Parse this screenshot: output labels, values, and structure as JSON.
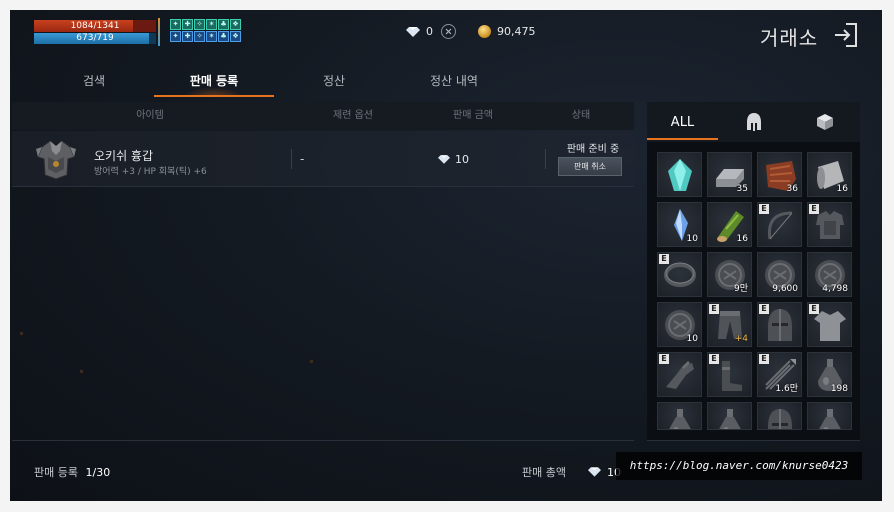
{
  "status_bars": {
    "hp": "1084/1341",
    "hp_ratio": 0.81,
    "mp": "673/719",
    "mp_ratio": 0.94
  },
  "buffs": [
    "buff-icon",
    "buff-icon",
    "buff-icon",
    "buff-icon",
    "buff-icon",
    "buff-icon",
    "buff-icon",
    "buff-icon",
    "buff-icon",
    "buff-icon",
    "buff-icon",
    "buff-icon"
  ],
  "currency": {
    "diamond": "0",
    "gold": "90,475"
  },
  "header": {
    "title": "거래소"
  },
  "tabs": [
    {
      "label": "검색"
    },
    {
      "label": "판매 등록"
    },
    {
      "label": "정산"
    },
    {
      "label": "정산 내역"
    }
  ],
  "table": {
    "headers": [
      "아이템",
      "제련 옵션",
      "판매 금액",
      "상태"
    ],
    "rows": [
      {
        "name": "오키쉬 흉갑",
        "stats": "방어력 +3 / HP 회복(틱) +6",
        "refine": "-",
        "price": "10",
        "status": "판매 준비 중",
        "action": "판매 취소"
      }
    ]
  },
  "footer": {
    "listed_label": "판매 등록",
    "listed_value": "1/30",
    "total_label": "판매 총액",
    "total_value": "10"
  },
  "inventory": {
    "tabs": [
      "ALL",
      "helmet-icon",
      "box-icon"
    ],
    "slots": [
      {
        "icon": "teal-crystal-icon",
        "count": "",
        "e": false
      },
      {
        "icon": "ingot-icon",
        "count": "35",
        "e": false
      },
      {
        "icon": "leather-icon",
        "count": "36",
        "e": false
      },
      {
        "icon": "cloth-roll-icon",
        "count": "16",
        "e": false
      },
      {
        "icon": "blue-crystal-icon",
        "count": "10",
        "e": false
      },
      {
        "icon": "wood-log-icon",
        "count": "16",
        "e": false
      },
      {
        "icon": "bow-icon",
        "count": "",
        "e": true
      },
      {
        "icon": "armor-icon",
        "count": "",
        "e": true
      },
      {
        "icon": "ring-icon",
        "count": "",
        "e": true
      },
      {
        "icon": "coin-icon",
        "count": "9만",
        "e": false
      },
      {
        "icon": "coin-icon",
        "count": "9,600",
        "e": false
      },
      {
        "icon": "coin-icon",
        "count": "4,798",
        "e": false
      },
      {
        "icon": "coin-icon",
        "count": "10",
        "e": false
      },
      {
        "icon": "pants-icon",
        "count": "+4",
        "e": true,
        "gold": true
      },
      {
        "icon": "helmet-icon",
        "count": "",
        "e": true
      },
      {
        "icon": "shirt-icon",
        "count": "",
        "e": true
      },
      {
        "icon": "gauntlet-icon",
        "count": "",
        "e": true
      },
      {
        "icon": "boots-icon",
        "count": "",
        "e": true
      },
      {
        "icon": "arrows-icon",
        "count": "1.6만",
        "e": true
      },
      {
        "icon": "potion-icon",
        "count": "198",
        "e": false
      },
      {
        "icon": "potion-icon",
        "count": "",
        "e": false
      },
      {
        "icon": "potion-icon",
        "count": "",
        "e": false
      },
      {
        "icon": "helmet-icon",
        "count": "",
        "e": false
      },
      {
        "icon": "potion-icon",
        "count": "",
        "e": false
      }
    ]
  },
  "watermark": "https://blog.naver.com/knurse0423"
}
